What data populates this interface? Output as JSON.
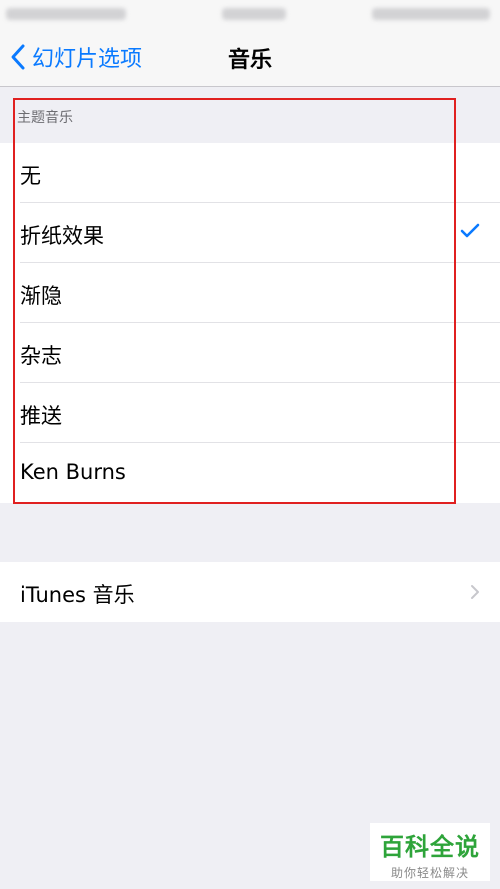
{
  "nav": {
    "back_label": "幻灯片选项",
    "title": "音乐"
  },
  "theme_music": {
    "header": "主题音乐",
    "options": [
      {
        "label": "无",
        "selected": false
      },
      {
        "label": "折纸效果",
        "selected": true
      },
      {
        "label": "渐隐",
        "selected": false
      },
      {
        "label": "杂志",
        "selected": false
      },
      {
        "label": "推送",
        "selected": false
      },
      {
        "label": "Ken Burns",
        "selected": false
      }
    ]
  },
  "itunes": {
    "label": "iTunes 音乐"
  },
  "watermark": {
    "title": "百科全说",
    "subtitle": "助你轻松解决"
  },
  "colors": {
    "accent": "#0a7aff",
    "highlight": "#e02020",
    "watermark": "#2ea43a"
  },
  "icons": {
    "back": "chevron-left-icon",
    "check": "checkmark-icon",
    "disclosure": "chevron-right-icon"
  }
}
